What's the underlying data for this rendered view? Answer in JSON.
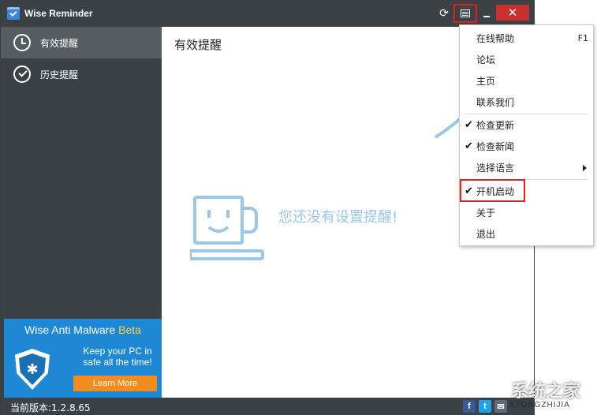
{
  "window": {
    "title": "Wise Reminder"
  },
  "sidebar": {
    "items": [
      {
        "label": "有效提醒",
        "icon": "clock-icon",
        "active": true
      },
      {
        "label": "历史提醒",
        "icon": "check-circle-icon",
        "active": false
      }
    ]
  },
  "content": {
    "title": "有效提醒",
    "empty_message": "您还没有设置提醒!"
  },
  "ad": {
    "title_main": "Wise Anti Malware ",
    "title_beta": "Beta",
    "line1": "Keep your PC in",
    "line2": "safe all the time!",
    "button": "Learn More"
  },
  "status": {
    "version": "当前版本:1.2.8.65"
  },
  "menu": {
    "items": [
      {
        "label": "在线帮助",
        "shortcut": "F1",
        "checked": false
      },
      {
        "label": "论坛",
        "checked": false
      },
      {
        "label": "主页",
        "checked": false
      },
      {
        "label": "联系我们",
        "checked": false
      },
      {
        "label": "检查更新",
        "checked": true
      },
      {
        "label": "检查新闻",
        "checked": true
      },
      {
        "label": "选择语言",
        "checked": false,
        "submenu": true
      },
      {
        "label": "开机启动",
        "checked": true
      },
      {
        "label": "关于",
        "checked": false
      },
      {
        "label": "退出",
        "checked": false
      }
    ],
    "check_glyph": "✔"
  },
  "watermark": {
    "text": "系统之家",
    "url": "XTONGZHIJIA"
  },
  "colors": {
    "dark": "#3c4146",
    "sidebar_active": "#575c61",
    "accent_blue": "#1f88d4",
    "highlight_red": "#e0201c",
    "close_red": "#c9302c",
    "empty_text": "#9cc6e8"
  }
}
